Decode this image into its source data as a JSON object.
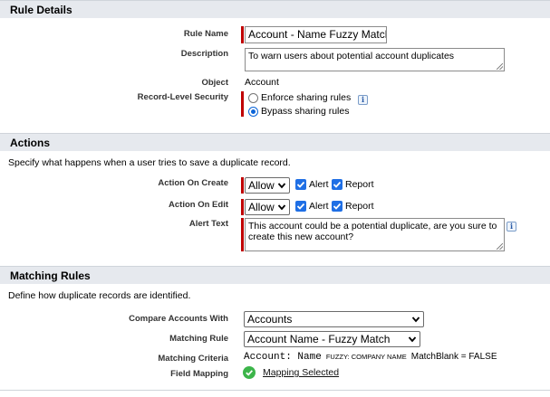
{
  "rule_details": {
    "header": "Rule Details",
    "rule_name_label": "Rule Name",
    "rule_name_value": "Account - Name Fuzzy Match",
    "description_label": "Description",
    "description_value": "To warn users about potential account duplicates",
    "object_label": "Object",
    "object_value": "Account",
    "security_label": "Record-Level Security",
    "security_options": [
      "Enforce sharing rules",
      "Bypass sharing rules"
    ],
    "security_selected": "Bypass sharing rules"
  },
  "actions": {
    "header": "Actions",
    "description": "Specify what happens when a user tries to save a duplicate record.",
    "on_create_label": "Action On Create",
    "on_create_value": "Allow",
    "on_edit_label": "Action On Edit",
    "on_edit_value": "Allow",
    "alert_label": "Alert",
    "report_label": "Report",
    "alert_text_label": "Alert Text",
    "alert_text_value": "This account could be a potential duplicate, are you sure to create this new account?"
  },
  "matching_rules": {
    "header": "Matching Rules",
    "description": "Define how duplicate records are identified.",
    "compare_label": "Compare Accounts With",
    "compare_value": "Accounts",
    "rule_label": "Matching Rule",
    "rule_value": "Account Name - Fuzzy Match",
    "criteria_label": "Matching Criteria",
    "criteria_field": "Account: Name",
    "criteria_method": "FUZZY: COMPANY NAME",
    "criteria_blank": "MatchBlank = FALSE",
    "mapping_label": "Field Mapping",
    "mapping_value": "Mapping Selected"
  },
  "colors": {
    "required_bar": "#c00000",
    "header_bg": "#e6e9ee",
    "checkbox": "#1f6fe5",
    "success": "#3cb54a"
  },
  "icons": [
    "info-icon",
    "chevron-down-icon",
    "checkmark-icon",
    "success-check-icon"
  ]
}
